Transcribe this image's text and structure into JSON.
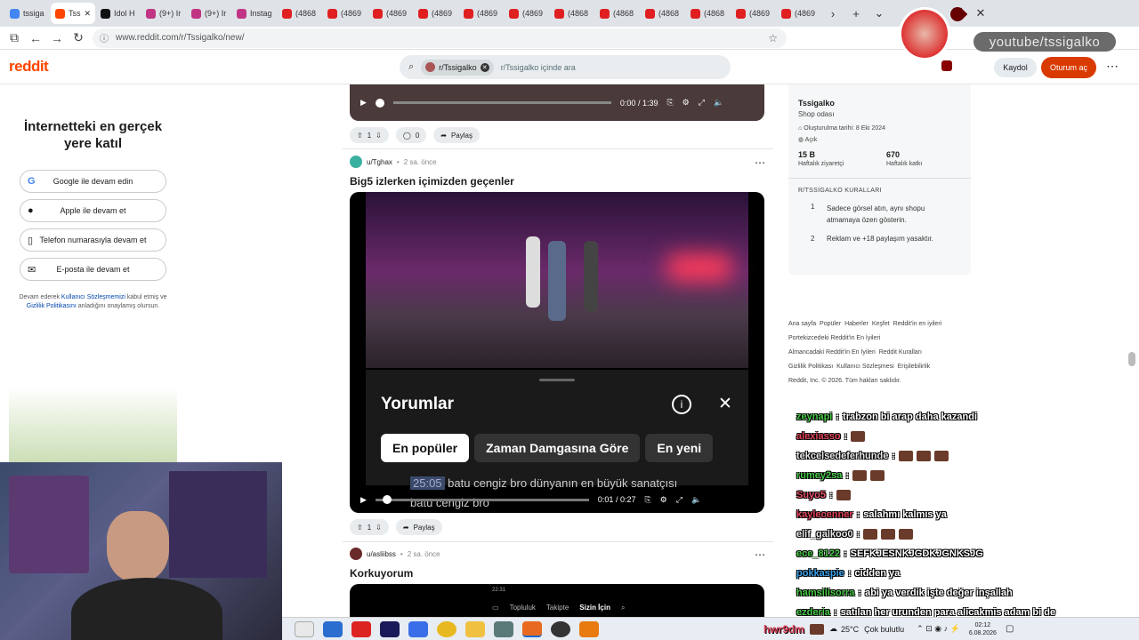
{
  "browser": {
    "tabs": [
      "tssiga",
      "Tss",
      "Idol H",
      "(9+) Ir",
      "(9+) Ir",
      "Instag",
      "(4868",
      "(4869",
      "(4869",
      "(4869",
      "(4869",
      "(4869",
      "(4868",
      "(4868",
      "(4868",
      "(4868",
      "(4869",
      "(4869"
    ],
    "url": "www.reddit.com/r/Tssigalko/new/"
  },
  "header": {
    "logo": "reddit",
    "search_chip": "r/Tssigalko",
    "search_placeholder": "r/Tssigalko içinde ara",
    "signup": "Kaydol",
    "login": "Oturum aç"
  },
  "left_panel": {
    "title": "İnternetteki en gerçek yere katıl",
    "buttons": [
      "Google ile devam edin",
      "Apple ile devam et",
      "Telefon numarasıyla devam et",
      "E-posta ile devam et"
    ],
    "legal_pre": "Devam ederek ",
    "legal_link1": "Kullanıcı Sözleşmemizi",
    "legal_mid": " kabul etmiş ve ",
    "legal_link2": "Gizlilik Politikasını",
    "legal_post": " anladığını onaylamış olursun."
  },
  "posts": [
    {
      "votes": "1",
      "comments": "0",
      "share": "Paylaş",
      "time": "0:00 / 1:39"
    },
    {
      "user": "u/Tghax",
      "age": "2 sa. önce",
      "title": "Big5 izlerken içimizden geçenler",
      "overlay_title": "Yorumlar",
      "overlay_tabs": [
        "En popüler",
        "Zaman Damgasına Göre",
        "En yeni"
      ],
      "caption_ts": "25:05",
      "caption_1": "batu cengiz bro dünyanın en büyük sanatçısı",
      "caption_2": "batu cengiz bro",
      "time": "0:01 / 0:27",
      "votes": "1",
      "share": "Paylaş"
    },
    {
      "user": "u/asliibss",
      "age": "2 sa. önce",
      "title": "Korkuyorum",
      "phone_time": "22:31",
      "phone_tabs": [
        "Topluluk",
        "Takipte",
        "Sizin İçin"
      ]
    }
  ],
  "sidebar": {
    "name": "Tssigalko",
    "subtitle": "Shop odası",
    "created": "Oluşturulma tarihi: 8 Eki 2024",
    "status": "Açık",
    "weekly_visitors": "15 B",
    "weekly_visitors_label": "Haftalık ziyaretçi",
    "weekly_contrib": "670",
    "weekly_contrib_label": "Haftalık katkı",
    "rules_title": "R/TSSİGALKO KURALLARI",
    "rules": [
      {
        "n": "1",
        "text": "Sadece görsel atın, aynı shopu atmamaya özen gösterin."
      },
      {
        "n": "2",
        "text": "Reklam ve +18 paylaşım yasaktır."
      }
    ]
  },
  "footer_links": [
    "Ana sayfa",
    "Popüler",
    "Haberler",
    "Keşfet",
    "Reddit'in en iyileri",
    "Portekizcedeki Reddit'in En İyileri",
    "Almancadaki Reddit'in En İyileri",
    "Reddit Kuralları",
    "Gizlilik Politikası",
    "Kullanıcı Sözleşmesi",
    "Erişilebilirlik",
    "Reddit, Inc. © 2026. Tüm hakları saklıdır."
  ],
  "chat": [
    {
      "user": "zeynapi",
      "color": "#46c946",
      "msg": "trabzon bi arap daha kazandi"
    },
    {
      "user": "alexiasso",
      "color": "#e0425a",
      "msg": ""
    },
    {
      "user": "tekcelsedeferhunde",
      "color": "#e8e8e8",
      "msg": ""
    },
    {
      "user": "rumey2sa",
      "color": "#46c946",
      "msg": ""
    },
    {
      "user": "Suyo5",
      "color": "#e8536a",
      "msg": ""
    },
    {
      "user": "kaylecenner",
      "color": "#e0425a",
      "msg": "salahmı kalmıs ya"
    },
    {
      "user": "elif_galkoo0",
      "color": "#e8e8e8",
      "msg": ""
    },
    {
      "user": "ece_8122",
      "color": "#46c946",
      "msg": "SEFKJESNKJGDKJGNKSJG"
    },
    {
      "user": "pokkaspie",
      "color": "#3aa0e8",
      "msg": "cidden ya"
    },
    {
      "user": "hamsilisorra",
      "color": "#46c946",
      "msg": "abi ya verdik işte değer inşallah"
    },
    {
      "user": "ezderia",
      "color": "#46c946",
      "msg": "satılan her urunden para alicakmis adam bi de"
    }
  ],
  "overlay": {
    "youtube": "youtube/tssigalko",
    "hwr": "hwr9dm"
  },
  "taskbar": {
    "weather": "25°C",
    "weather_text": "Çok bulutlu",
    "time": "02:12",
    "date": "6.08.2026"
  }
}
